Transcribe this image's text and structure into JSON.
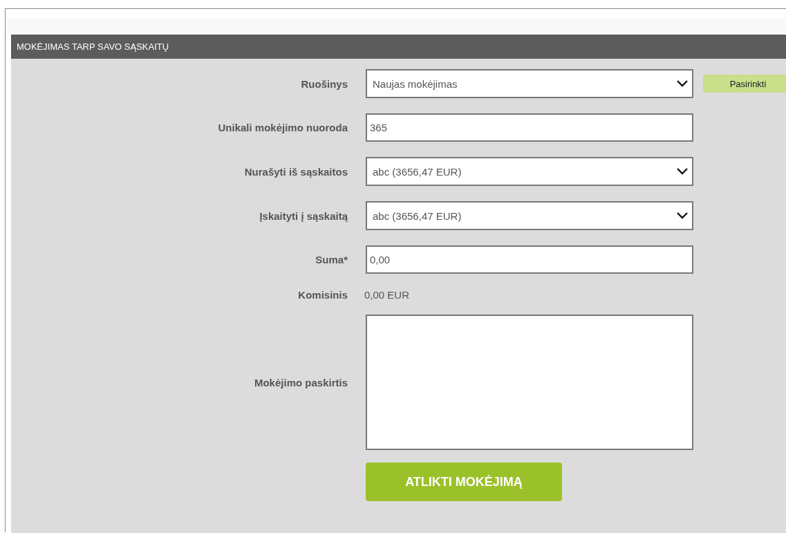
{
  "panel": {
    "title": "MOKĖJIMAS TARP SAVO SĄSKAITŲ"
  },
  "fields": [
    {
      "kind": "select",
      "label": "Ruošinys",
      "value": "Naujas mokėjimas",
      "action": "Pasirinkti"
    },
    {
      "kind": "input",
      "label": "Unikali mokėjimo nuoroda",
      "value": "365"
    },
    {
      "kind": "select",
      "label": "Nurašyti iš sąskaitos",
      "value": "abc (3656,47 EUR)"
    },
    {
      "kind": "select",
      "label": "Įskaityti į sąskaitą",
      "value": "abc (3656,47 EUR)"
    },
    {
      "kind": "input",
      "label": "Suma*",
      "value": "0,00"
    },
    {
      "kind": "text",
      "label": "Komisinis",
      "value": "0,00 EUR"
    },
    {
      "kind": "textarea",
      "label": "Mokėjimo paskirtis"
    }
  ],
  "submit": "ATLIKTI MOKĖJIMĄ"
}
